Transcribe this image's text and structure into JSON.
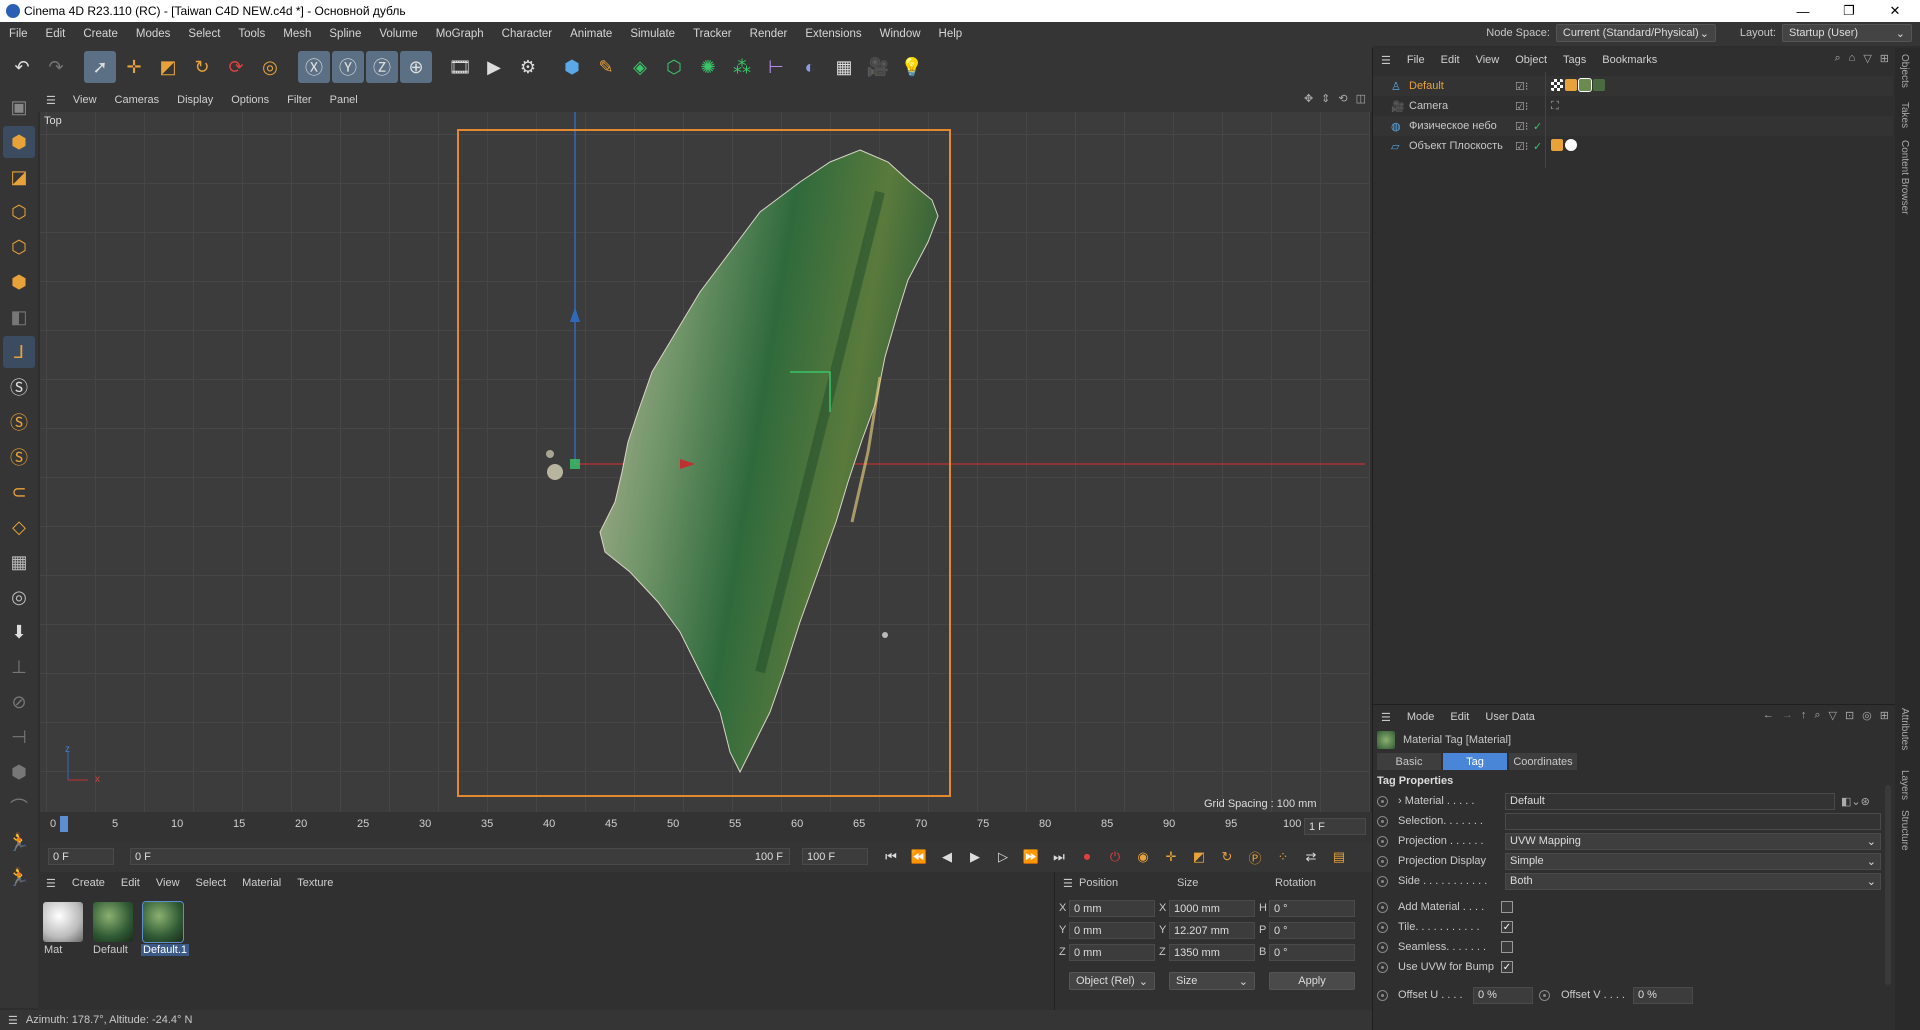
{
  "window": {
    "title": "Cinema 4D R23.110 (RC) - [Taiwan C4D NEW.c4d *] - Основной дубль",
    "controls": [
      "—",
      "❐",
      "✕"
    ]
  },
  "menubar": {
    "items": [
      "File",
      "Edit",
      "Create",
      "Modes",
      "Select",
      "Tools",
      "Mesh",
      "Spline",
      "Volume",
      "MoGraph",
      "Character",
      "Animate",
      "Simulate",
      "Tracker",
      "Render",
      "Extensions",
      "Window",
      "Help"
    ],
    "node_space_label": "Node Space:",
    "node_space_value": "Current (Standard/Physical)",
    "layout_label": "Layout:",
    "layout_value": "Startup (User)"
  },
  "viewport": {
    "menu": [
      "View",
      "Cameras",
      "Display",
      "Options",
      "Filter",
      "Panel"
    ],
    "view_name": "Top",
    "grid_spacing": "Grid Spacing : 100 mm",
    "axis_x": "x",
    "axis_z": "z"
  },
  "timeline": {
    "ticks": [
      "0",
      "5",
      "10",
      "15",
      "20",
      "25",
      "30",
      "35",
      "40",
      "45",
      "50",
      "55",
      "60",
      "65",
      "70",
      "75",
      "80",
      "85",
      "90",
      "95",
      "100"
    ],
    "current_frame_box": "1 F"
  },
  "playbar": {
    "start": "0 F",
    "current": "0 F",
    "end_inner": "100 F",
    "end": "100 F"
  },
  "materials": {
    "menu": [
      "Create",
      "Edit",
      "View",
      "Select",
      "Material",
      "Texture"
    ],
    "items": [
      "Mat",
      "Default",
      "Default.1"
    ]
  },
  "coords": {
    "headers": [
      "Position",
      "Size",
      "Rotation"
    ],
    "rows": [
      {
        "axis": "X",
        "pos": "0 mm",
        "size_axis": "X",
        "size": "1000 mm",
        "rot_axis": "H",
        "rot": "0 °"
      },
      {
        "axis": "Y",
        "pos": "0 mm",
        "size_axis": "Y",
        "size": "12.207 mm",
        "rot_axis": "P",
        "rot": "0 °"
      },
      {
        "axis": "Z",
        "pos": "0 mm",
        "size_axis": "Z",
        "size": "1350 mm",
        "rot_axis": "B",
        "rot": "0 °"
      }
    ],
    "mode_value": "Object (Rel)",
    "size_mode_value": "Size",
    "apply_label": "Apply"
  },
  "objects": {
    "menu": [
      "File",
      "Edit",
      "View",
      "Object",
      "Tags",
      "Bookmarks"
    ],
    "items": [
      "Default",
      "Camera",
      "Физическое небо",
      "Объект Плоскость"
    ]
  },
  "attributes": {
    "menu": [
      "Mode",
      "Edit",
      "User Data"
    ],
    "title": "Material Tag [Material]",
    "tabs": [
      "Basic",
      "Tag",
      "Coordinates"
    ],
    "section": "Tag Properties",
    "material_label": "› Material . . . . .",
    "material_value": "Default",
    "selection_label": "Selection. . . . . . .",
    "projection_label": "Projection . . . . . .",
    "projection_value": "UVW Mapping",
    "projection_display_label": "Projection Display",
    "projection_display_value": "Simple",
    "side_label": "Side . . . . . . . . . . .",
    "side_value": "Both",
    "add_material_label": "Add Material . . . .",
    "tile_label": "Tile. . . . . . . . . . .",
    "seamless_label": "Seamless. . . . . . .",
    "use_uvw_label": "Use UVW for Bump",
    "offset_u_label": "Offset U . . . .",
    "offset_u_value": "0 %",
    "offset_v_label": "Offset V . . . .",
    "offset_v_value": "0 %"
  },
  "right_tabs": [
    "Objects",
    "Takes",
    "Content Browser",
    "Attributes",
    "Layers",
    "Structure"
  ],
  "status": {
    "text": "Azimuth: 178.7°, Altitude: -24.4°  N"
  }
}
